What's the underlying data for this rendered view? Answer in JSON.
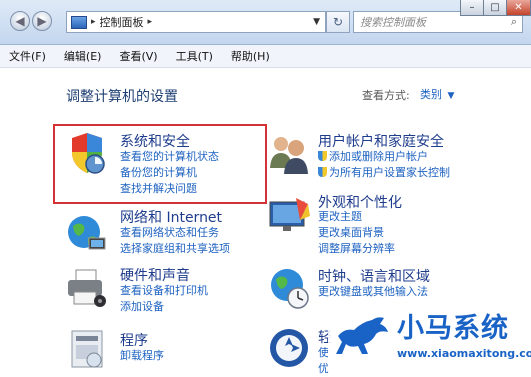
{
  "address_bar": {
    "path": "控制面板"
  },
  "search": {
    "placeholder": "搜索控制面板"
  },
  "window_buttons": {
    "minimize": "–",
    "maximize": "□",
    "close": "✕"
  },
  "menu": [
    "文件(F)",
    "编辑(E)",
    "查看(V)",
    "工具(T)",
    "帮助(H)"
  ],
  "page": {
    "title": "调整计算机的设置",
    "view_by_label": "查看方式:",
    "view_by_value": "类别"
  },
  "categories": [
    {
      "title": "系统和安全",
      "links": [
        "查看您的计算机状态",
        "备份您的计算机",
        "查找并解决问题"
      ],
      "icon": "shield-icon"
    },
    {
      "title": "网络和 Internet",
      "links": [
        "查看网络状态和任务",
        "选择家庭组和共享选项"
      ],
      "icon": "network-globe-icon"
    },
    {
      "title": "硬件和声音",
      "links": [
        "查看设备和打印机",
        "添加设备"
      ],
      "icon": "printer-icon"
    },
    {
      "title": "程序",
      "links": [
        "卸载程序"
      ],
      "icon": "programs-icon"
    },
    {
      "title": "用户帐户和家庭安全",
      "links": [
        "添加或删除用户帐户",
        "为所有用户设置家长控制"
      ],
      "icon": "users-icon"
    },
    {
      "title": "外观和个性化",
      "links": [
        "更改主题",
        "更改桌面背景",
        "调整屏幕分辨率"
      ],
      "icon": "appearance-icon"
    },
    {
      "title": "时钟、语言和区域",
      "links": [
        "更改键盘或其他输入法"
      ],
      "icon": "clock-globe-icon"
    },
    {
      "title": "轻",
      "links": [
        "使",
        "优"
      ],
      "icon": "ease-of-access-icon"
    }
  ],
  "watermark": {
    "title": "小马系统",
    "url": "www.xiaomaxitong.com"
  },
  "colors": {
    "link": "#1e62c0",
    "highlight": "#d33236",
    "heading": "#1e3c8c"
  }
}
